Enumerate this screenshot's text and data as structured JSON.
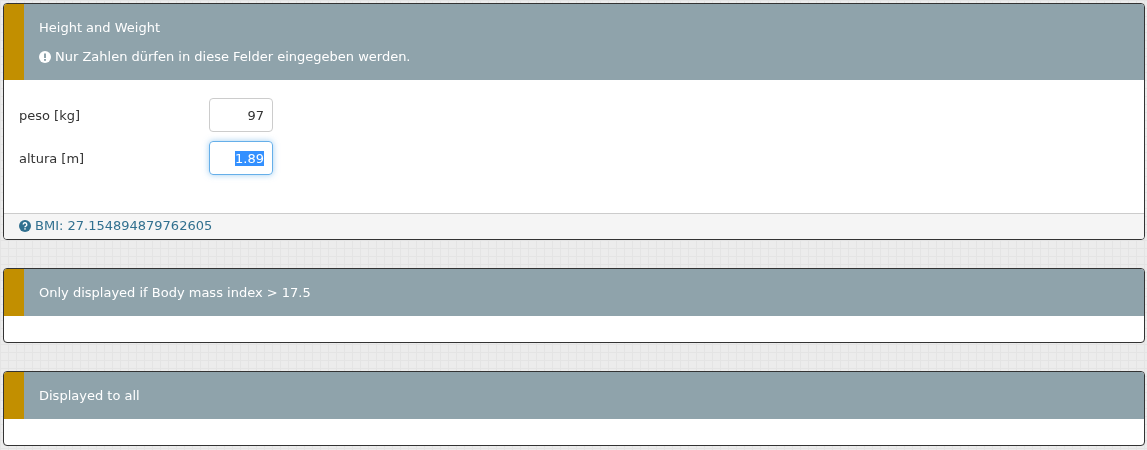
{
  "panels": [
    {
      "title": "Height and Weight",
      "notice": "Nur Zahlen dürfen in diese Felder eingegeben werden.",
      "fields": [
        {
          "label": "peso [kg]",
          "value": "97",
          "focused": false,
          "selected": false
        },
        {
          "label": "altura [m]",
          "value": "1.89",
          "focused": true,
          "selected": true
        }
      ],
      "footer": "BMI: 27.154894879762605"
    },
    {
      "title": "Only displayed if Body mass index > 17.5"
    },
    {
      "title": "Displayed to all"
    }
  ]
}
